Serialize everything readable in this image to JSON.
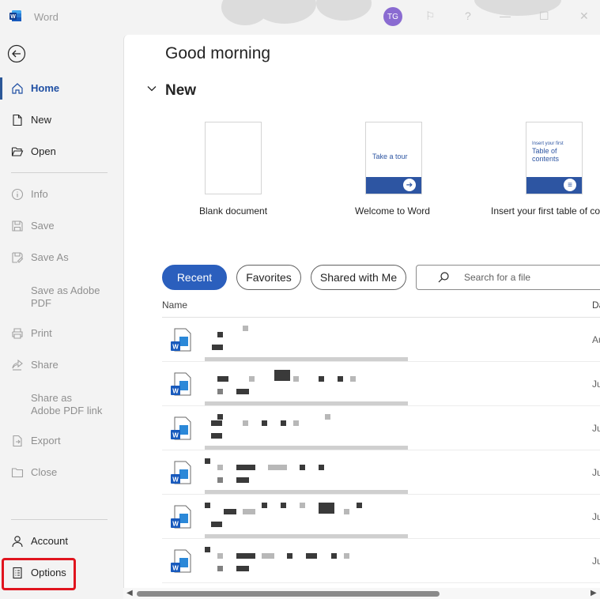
{
  "app": {
    "name": "Word",
    "avatar_initials": "TG",
    "accent": "#2b5797"
  },
  "sidebar": {
    "back_icon": "back-arrow-icon",
    "items": [
      {
        "label": "Home",
        "icon": "home-icon",
        "state": "active"
      },
      {
        "label": "New",
        "icon": "new-document-icon",
        "state": "enabled"
      },
      {
        "label": "Open",
        "icon": "folder-open-icon",
        "state": "enabled"
      },
      {
        "label": "Info",
        "icon": "info-icon",
        "state": "disabled"
      },
      {
        "label": "Save",
        "icon": "save-icon",
        "state": "disabled"
      },
      {
        "label": "Save As",
        "icon": "save-as-icon",
        "state": "disabled"
      },
      {
        "label": "Save as Adobe PDF",
        "icon": "",
        "state": "disabled"
      },
      {
        "label": "Print",
        "icon": "print-icon",
        "state": "disabled"
      },
      {
        "label": "Share",
        "icon": "share-icon",
        "state": "disabled"
      },
      {
        "label": "Share as Adobe PDF link",
        "icon": "",
        "state": "disabled"
      },
      {
        "label": "Export",
        "icon": "export-icon",
        "state": "disabled"
      },
      {
        "label": "Close",
        "icon": "close-folder-icon",
        "state": "disabled"
      },
      {
        "label": "Account",
        "icon": "account-icon",
        "state": "enabled"
      },
      {
        "label": "Options",
        "icon": "options-icon",
        "state": "enabled"
      }
    ]
  },
  "main": {
    "greeting": "Good morning",
    "new_section_title": "New",
    "templates": [
      {
        "caption": "Blank document"
      },
      {
        "caption": "Welcome to Word",
        "thumb_text": "Take a tour"
      },
      {
        "caption": "Insert your first table of co",
        "thumb_small": "Insert your first",
        "thumb_big": "Table of contents"
      }
    ],
    "tabs": [
      {
        "label": "Recent",
        "active": true
      },
      {
        "label": "Favorites",
        "active": false
      },
      {
        "label": "Shared with Me",
        "active": false
      }
    ],
    "search": {
      "placeholder": "Search for a file"
    },
    "columns": {
      "name": "Name",
      "date": "Da"
    },
    "files": [
      {
        "date": "Au"
      },
      {
        "date": "Ju"
      },
      {
        "date": "Ju"
      },
      {
        "date": "Ju"
      },
      {
        "date": "Ju"
      },
      {
        "date": "Ju"
      }
    ]
  }
}
